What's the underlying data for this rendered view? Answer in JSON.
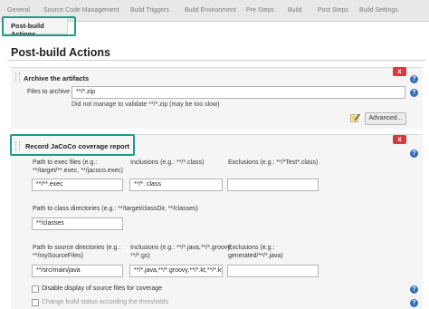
{
  "tabs": [
    {
      "label": "General"
    },
    {
      "label": "Source Code Management"
    },
    {
      "label": "Build Triggers"
    },
    {
      "label": "Build Environment"
    },
    {
      "label": "Pre Steps"
    },
    {
      "label": "Build"
    },
    {
      "label": "Post Steps"
    },
    {
      "label": "Build Settings"
    }
  ],
  "active_tab": {
    "label": "Post-build Actions"
  },
  "page_title": "Post-build Actions",
  "archive": {
    "heading": "Archive the artifacts",
    "files_label": "Files to archive",
    "files_value": "**/*.zip",
    "warning": "Did not manage to validate **/*.zip (may be too slow)",
    "advanced_label": "Advanced...",
    "delete_label": "x",
    "help_label": "?"
  },
  "jacoco": {
    "heading": "Record JaCoCo coverage report",
    "delete_label": "x",
    "help_label": "?",
    "exec_label_1": "Path to exec files (e.g.:",
    "exec_label_2": "**/target/**.exec, **/jacoco.exec)",
    "exec_value": "**/**.exec",
    "incl_label": "Inclusions (e.g.: **/*.class)",
    "incl_value": "**/*. class",
    "excl_label": "Exclusions (e.g.: **/*Test*.class)",
    "excl_value": "",
    "class_label": "Path to class directories (e.g.: **/target/classDir, **/classes)",
    "class_value": "**/classes",
    "src_label_1": "Path to source directories (e.g.:",
    "src_label_2": "**/mySourceFiles)",
    "src_value": "**/src/main/java",
    "src_incl_label_1": "Inclusions (e.g.: **/*.java,**/*.groovy,",
    "src_incl_label_2": "**/*.gs)",
    "src_incl_value": "**/*.java,**/*.groovy,**/*.kt,**/*.kts",
    "src_excl_label_1": "Exclusions (e.g.:",
    "src_excl_label_2": "generated/**/*.java)",
    "src_excl_value": "",
    "disable_label": "Disable display of source files for coverage",
    "change_label": "Change build status according the thresholds"
  },
  "colors": {
    "highlight": "#1a9e8a",
    "delete": "#d9363e",
    "help": "#2f6fb5"
  }
}
